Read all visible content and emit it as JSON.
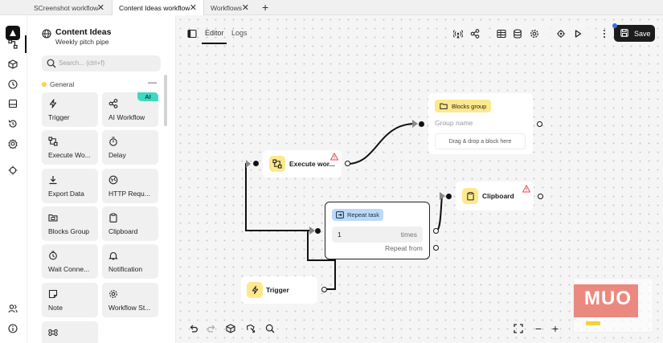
{
  "tabs": [
    {
      "label": "SCreenshot workflow"
    },
    {
      "label": "Content Ideas workflow"
    },
    {
      "label": "Workflows"
    }
  ],
  "workflow": {
    "title": "Content Ideas",
    "subtitle": "Weekly pitch pipe"
  },
  "search": {
    "placeholder": "Search... (ctrl+f)"
  },
  "group": {
    "label": "General",
    "collapse": "—"
  },
  "blocks": [
    {
      "label": "Trigger",
      "icon": "lightning-icon"
    },
    {
      "label": "AI Workflow",
      "icon": "share-nodes-icon",
      "badge": "AI"
    },
    {
      "label": "Execute Wo...",
      "icon": "workflow-icon"
    },
    {
      "label": "Delay",
      "icon": "timer-icon"
    },
    {
      "label": "Export Data",
      "icon": "download-icon"
    },
    {
      "label": "HTTP Requ...",
      "icon": "globe-icon"
    },
    {
      "label": "Blocks Group",
      "icon": "folder-icon"
    },
    {
      "label": "Clipboard",
      "icon": "clipboard-icon"
    },
    {
      "label": "Wait Conne...",
      "icon": "stopwatch-icon"
    },
    {
      "label": "Notification",
      "icon": "bell-icon"
    },
    {
      "label": "Note",
      "icon": "note-icon"
    },
    {
      "label": "Workflow St...",
      "icon": "gear-icon"
    }
  ],
  "editor_tabs": {
    "editor": "Editor",
    "logs": "Logs"
  },
  "save": {
    "label": "Save"
  },
  "nodes": {
    "execute": {
      "label": "Execute wor..."
    },
    "blocks_group": {
      "chip": "Blocks group",
      "placeholder": "Group name",
      "dropzone": "Drag & drop a block here"
    },
    "clipboard": {
      "label": "Clipboard"
    },
    "repeat": {
      "chip": "Repeat task",
      "value": "1",
      "unit": "times",
      "repeat_from": "Repeat from"
    },
    "trigger": {
      "label": "Trigger"
    }
  },
  "watermark": {
    "text": "MUO"
  },
  "colors": {
    "accent_yellow": "#fde98c",
    "chip_blue": "#bcd9f7",
    "ai_teal": "#3fd8c0",
    "save_dark": "#1c1c1c"
  }
}
